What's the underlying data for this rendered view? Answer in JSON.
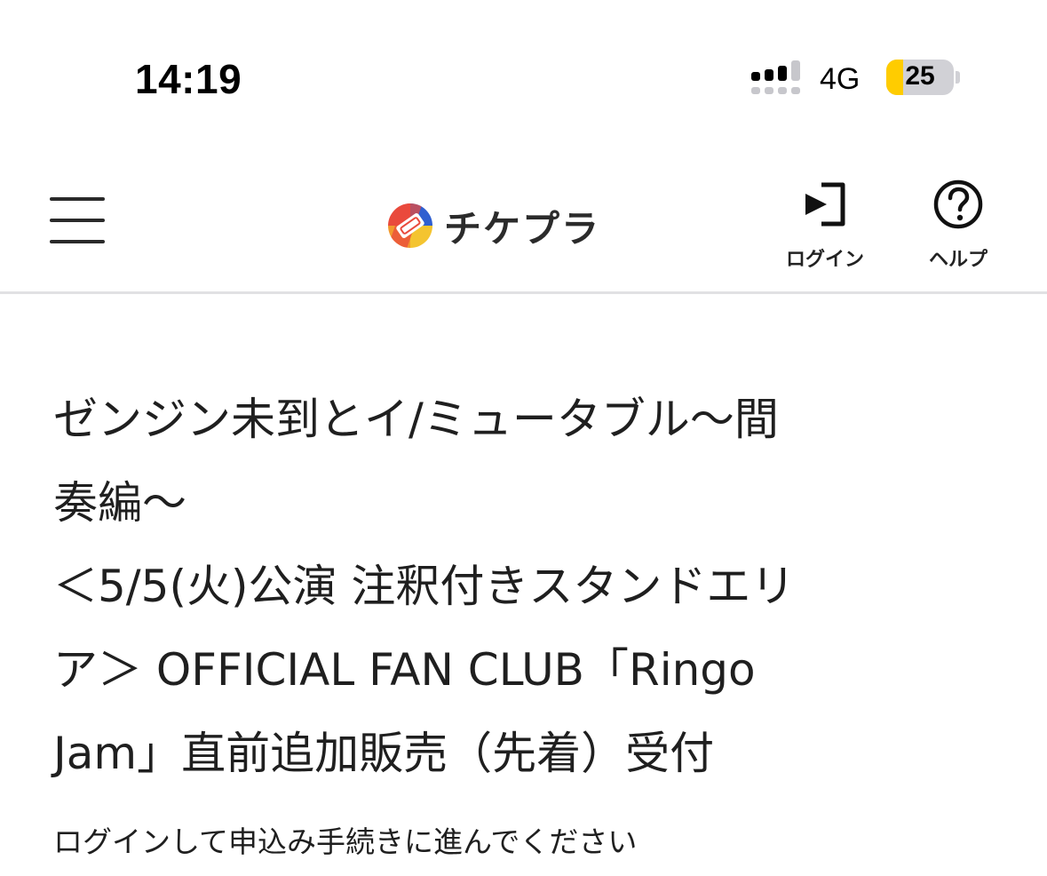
{
  "status_bar": {
    "time": "14:19",
    "network": "4G",
    "battery_level": "25",
    "battery_fraction": 0.25
  },
  "header": {
    "logo_text": "チケプラ",
    "login_label": "ログイン",
    "help_label": "ヘルプ"
  },
  "main": {
    "title": "ゼンジン未到とイ/ミュータブル〜間奏編〜\n＜5/5(火)公演 注釈付きスタンドエリア＞ OFFICIAL FAN CLUB「Ringo Jam」直前追加販売（先着）受付",
    "title_line_1": "ゼンジン未到とイ/ミュータブル〜間",
    "title_line_2": "奏編〜",
    "title_line_3": "＜5/5(火)公演 注釈付きスタンドエリ",
    "title_line_4": "ア＞ OFFICIAL FAN CLUB「Ringo",
    "title_line_5": "Jam」直前追加販売（先着）受付",
    "login_note": "ログインして申込み手続きに進んでください"
  },
  "colors": {
    "battery_fill": "#ffcc00",
    "divider": "#e1e1e3",
    "text": "#1f1f1f"
  },
  "icons": {
    "menu": "hamburger-icon",
    "login": "login-arrow-icon",
    "help": "question-circle-icon",
    "logo": "ticket-logo-icon"
  }
}
